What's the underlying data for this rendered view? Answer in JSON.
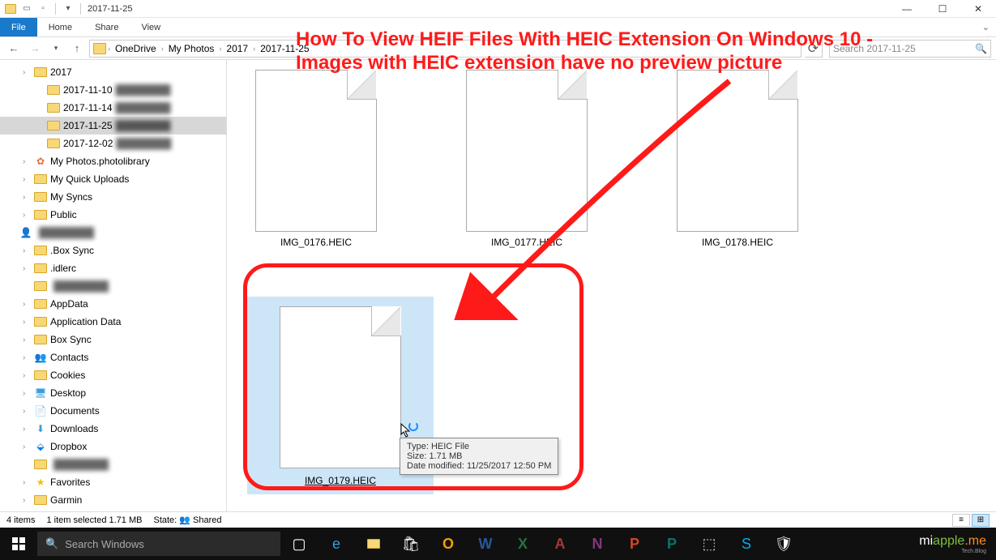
{
  "titlebar": {
    "title": "2017-11-25"
  },
  "ribbon": {
    "file": "File",
    "home": "Home",
    "share": "Share",
    "view": "View"
  },
  "address": {
    "crumbs": [
      "OneDrive",
      "My Photos",
      "2017",
      "2017-11-25"
    ],
    "search_placeholder": "Search 2017-11-25"
  },
  "tree": [
    {
      "label": "2017",
      "depth": 1,
      "icon": "folder"
    },
    {
      "label": "2017-11-10",
      "depth": 2,
      "icon": "folder",
      "blur": true
    },
    {
      "label": "2017-11-14",
      "depth": 2,
      "icon": "folder",
      "blur": true
    },
    {
      "label": "2017-11-25",
      "depth": 2,
      "icon": "folder",
      "selected": true,
      "blur": true
    },
    {
      "label": "2017-12-02",
      "depth": 2,
      "icon": "folder",
      "blur": true
    },
    {
      "label": "My Photos.photolibrary",
      "depth": 1,
      "icon": "photos"
    },
    {
      "label": "My Quick Uploads",
      "depth": 1,
      "icon": "folder"
    },
    {
      "label": "My Syncs",
      "depth": 1,
      "icon": "folder"
    },
    {
      "label": "Public",
      "depth": 1,
      "icon": "folder"
    },
    {
      "label": "",
      "depth": 0,
      "icon": "user",
      "blur": true
    },
    {
      "label": ".Box Sync",
      "depth": 1,
      "icon": "folder"
    },
    {
      "label": ".idlerc",
      "depth": 1,
      "icon": "folder"
    },
    {
      "label": "",
      "depth": 1,
      "icon": "folder",
      "blur": true
    },
    {
      "label": "AppData",
      "depth": 1,
      "icon": "folder"
    },
    {
      "label": "Application Data",
      "depth": 1,
      "icon": "folder"
    },
    {
      "label": "Box Sync",
      "depth": 1,
      "icon": "folder"
    },
    {
      "label": "Contacts",
      "depth": 1,
      "icon": "contacts"
    },
    {
      "label": "Cookies",
      "depth": 1,
      "icon": "folder"
    },
    {
      "label": "Desktop",
      "depth": 1,
      "icon": "desktop"
    },
    {
      "label": "Documents",
      "depth": 1,
      "icon": "documents"
    },
    {
      "label": "Downloads",
      "depth": 1,
      "icon": "downloads"
    },
    {
      "label": "Dropbox",
      "depth": 1,
      "icon": "dropbox"
    },
    {
      "label": "",
      "depth": 1,
      "icon": "folder",
      "blur": true
    },
    {
      "label": "Favorites",
      "depth": 1,
      "icon": "favorites"
    },
    {
      "label": "Garmin",
      "depth": 1,
      "icon": "folder"
    }
  ],
  "files": [
    {
      "name": "IMG_0176.HEIC"
    },
    {
      "name": "IMG_0177.HEIC"
    },
    {
      "name": "IMG_0178.HEIC"
    },
    {
      "name": "IMG_0179.HEIC",
      "selected": true
    }
  ],
  "tooltip": {
    "type": "Type: HEIC File",
    "size": "Size: 1.71 MB",
    "modified": "Date modified: 11/25/2017 12:50 PM"
  },
  "annotation": {
    "text": "How To View HEIF Files With HEIC Extension On Windows 10 - Images with HEIC extension have no preview picture"
  },
  "statusbar": {
    "count": "4 items",
    "selected": "1 item selected  1.71 MB",
    "state_label": "State:",
    "state_value": "Shared"
  },
  "taskbar": {
    "search_placeholder": "Search Windows"
  },
  "watermark": {
    "part1": "mi",
    "part2": "apple",
    "part3": ".me",
    "sub": "Tech.Blog"
  }
}
